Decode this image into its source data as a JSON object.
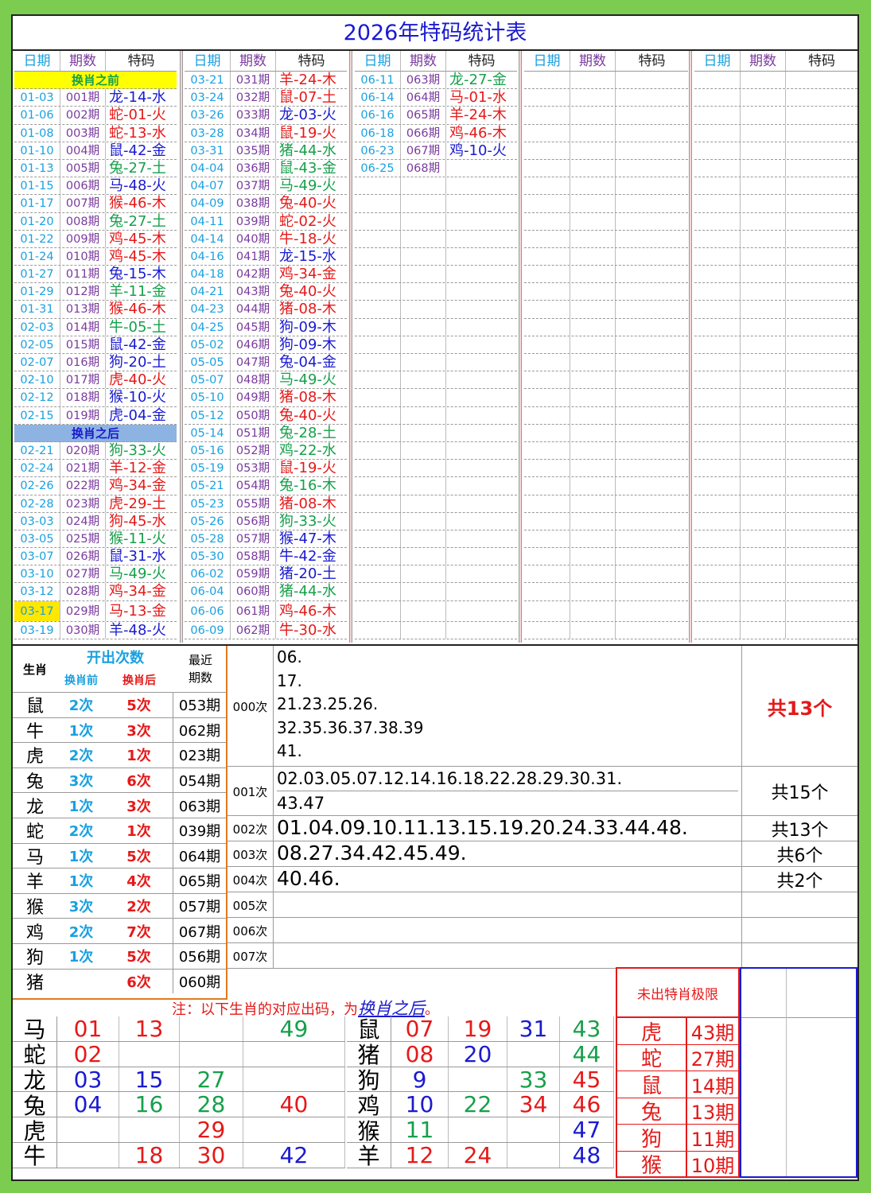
{
  "title": "2026年特码统计表",
  "headers": {
    "date": "日期",
    "period": "期数",
    "code": "特码"
  },
  "sep_before": "换肖之前",
  "sep_after": "换肖之后",
  "col1": [
    [
      "01-03",
      "001期",
      "龙-14-水",
      "bl"
    ],
    [
      "01-06",
      "002期",
      "蛇-01-火",
      "rd"
    ],
    [
      "01-08",
      "003期",
      "蛇-13-水",
      "rd"
    ],
    [
      "01-10",
      "004期",
      "鼠-42-金",
      "bl"
    ],
    [
      "01-13",
      "005期",
      "兔-27-土",
      "gr"
    ],
    [
      "01-15",
      "006期",
      "马-48-火",
      "bl"
    ],
    [
      "01-17",
      "007期",
      "猴-46-木",
      "rd"
    ],
    [
      "01-20",
      "008期",
      "兔-27-土",
      "gr"
    ],
    [
      "01-22",
      "009期",
      "鸡-45-木",
      "rd"
    ],
    [
      "01-24",
      "010期",
      "鸡-45-木",
      "rd"
    ],
    [
      "01-27",
      "011期",
      "兔-15-木",
      "bl"
    ],
    [
      "01-29",
      "012期",
      "羊-11-金",
      "gr"
    ],
    [
      "01-31",
      "013期",
      "猴-46-木",
      "rd"
    ],
    [
      "02-03",
      "014期",
      "牛-05-土",
      "gr"
    ],
    [
      "02-05",
      "015期",
      "鼠-42-金",
      "bl"
    ],
    [
      "02-07",
      "016期",
      "狗-20-土",
      "bl"
    ],
    [
      "02-10",
      "017期",
      "虎-40-火",
      "rd"
    ],
    [
      "02-12",
      "018期",
      "猴-10-火",
      "bl"
    ],
    [
      "02-15",
      "019期",
      "虎-04-金",
      "bl"
    ]
  ],
  "col1b": [
    [
      "02-21",
      "020期",
      "狗-33-火",
      "gr"
    ],
    [
      "02-24",
      "021期",
      "羊-12-金",
      "rd"
    ],
    [
      "02-26",
      "022期",
      "鸡-34-金",
      "rd"
    ],
    [
      "02-28",
      "023期",
      "虎-29-土",
      "rd"
    ],
    [
      "03-03",
      "024期",
      "狗-45-水",
      "rd"
    ],
    [
      "03-05",
      "025期",
      "猴-11-火",
      "gr"
    ],
    [
      "03-07",
      "026期",
      "鼠-31-水",
      "bl"
    ],
    [
      "03-10",
      "027期",
      "马-49-火",
      "gr"
    ],
    [
      "03-12",
      "028期",
      "鸡-34-金",
      "rd"
    ],
    [
      "03-17",
      "029期",
      "马-13-金",
      "rd"
    ],
    [
      "03-19",
      "030期",
      "羊-48-火",
      "bl"
    ]
  ],
  "col2": [
    [
      "03-21",
      "031期",
      "羊-24-木",
      "rd"
    ],
    [
      "03-24",
      "032期",
      "鼠-07-土",
      "rd"
    ],
    [
      "03-26",
      "033期",
      "龙-03-火",
      "bl"
    ],
    [
      "03-28",
      "034期",
      "鼠-19-火",
      "rd"
    ],
    [
      "03-31",
      "035期",
      "猪-44-水",
      "gr"
    ],
    [
      "04-04",
      "036期",
      "鼠-43-金",
      "gr"
    ],
    [
      "04-07",
      "037期",
      "马-49-火",
      "gr"
    ],
    [
      "04-09",
      "038期",
      "兔-40-火",
      "rd"
    ],
    [
      "04-11",
      "039期",
      "蛇-02-火",
      "rd"
    ],
    [
      "04-14",
      "040期",
      "牛-18-火",
      "rd"
    ],
    [
      "04-16",
      "041期",
      "龙-15-水",
      "bl"
    ],
    [
      "04-18",
      "042期",
      "鸡-34-金",
      "rd"
    ],
    [
      "04-21",
      "043期",
      "兔-40-火",
      "rd"
    ],
    [
      "04-23",
      "044期",
      "猪-08-木",
      "rd"
    ],
    [
      "04-25",
      "045期",
      "狗-09-木",
      "bl"
    ],
    [
      "05-02",
      "046期",
      "狗-09-木",
      "bl"
    ],
    [
      "05-05",
      "047期",
      "兔-04-金",
      "bl"
    ],
    [
      "05-07",
      "048期",
      "马-49-火",
      "gr"
    ],
    [
      "05-10",
      "049期",
      "猪-08-木",
      "rd"
    ],
    [
      "05-12",
      "050期",
      "兔-40-火",
      "rd"
    ],
    [
      "05-14",
      "051期",
      "兔-28-土",
      "gr"
    ],
    [
      "05-16",
      "052期",
      "鸡-22-水",
      "gr"
    ],
    [
      "05-19",
      "053期",
      "鼠-19-火",
      "rd"
    ],
    [
      "05-21",
      "054期",
      "兔-16-木",
      "gr"
    ],
    [
      "05-23",
      "055期",
      "猪-08-木",
      "rd"
    ],
    [
      "05-26",
      "056期",
      "狗-33-火",
      "gr"
    ],
    [
      "05-28",
      "057期",
      "猴-47-木",
      "bl"
    ],
    [
      "05-30",
      "058期",
      "牛-42-金",
      "bl"
    ],
    [
      "06-02",
      "059期",
      "猪-20-土",
      "bl"
    ],
    [
      "06-04",
      "060期",
      "猪-44-水",
      "gr"
    ],
    [
      "06-06",
      "061期",
      "鸡-46-木",
      "rd"
    ],
    [
      "06-09",
      "062期",
      "牛-30-水",
      "rd"
    ]
  ],
  "col3": [
    [
      "06-11",
      "063期",
      "龙-27-金",
      "gr"
    ],
    [
      "06-14",
      "064期",
      "马-01-水",
      "rd"
    ],
    [
      "06-16",
      "065期",
      "羊-24-木",
      "rd"
    ],
    [
      "06-18",
      "066期",
      "鸡-46-木",
      "rd"
    ],
    [
      "06-23",
      "067期",
      "鸡-10-火",
      "bl"
    ],
    [
      "06-25",
      "068期",
      "",
      ""
    ]
  ],
  "stats": {
    "h_zodiac": "生肖",
    "h_count": "开出次数",
    "h_before": "换肖前",
    "h_after": "换肖后",
    "h_recent": "最近期数",
    "rows": [
      [
        "鼠",
        "2次",
        "5次",
        "053期"
      ],
      [
        "牛",
        "1次",
        "3次",
        "062期"
      ],
      [
        "虎",
        "2次",
        "1次",
        "023期"
      ],
      [
        "兔",
        "3次",
        "6次",
        "054期"
      ],
      [
        "龙",
        "1次",
        "3次",
        "063期"
      ],
      [
        "蛇",
        "2次",
        "1次",
        "039期"
      ],
      [
        "马",
        "1次",
        "5次",
        "064期"
      ],
      [
        "羊",
        "1次",
        "4次",
        "065期"
      ],
      [
        "猴",
        "3次",
        "2次",
        "057期"
      ],
      [
        "鸡",
        "2次",
        "7次",
        "067期"
      ],
      [
        "狗",
        "1次",
        "5次",
        "056期"
      ],
      [
        "猪",
        "",
        "6次",
        "060期"
      ]
    ]
  },
  "freq": [
    {
      "label": "000次",
      "lines": [
        "06.",
        "17.",
        "21.23.25.26.",
        "32.35.36.37.38.39",
        "41."
      ],
      "total": "共13个"
    },
    {
      "label": "001次",
      "lines": [
        "02.03.05.07.12.14.16.18.22.28.29.30.31.",
        "43.47"
      ],
      "total": "共15个"
    },
    {
      "label": "002次",
      "lines": [
        "01.04.09.10.11.13.15.19.20.24.33.44.48."
      ],
      "total": "共13个"
    },
    {
      "label": "003次",
      "lines": [
        "08.27.34.42.45.49."
      ],
      "total": "共6个"
    },
    {
      "label": "004次",
      "lines": [
        "40.46."
      ],
      "total": "共2个"
    },
    {
      "label": "005次",
      "lines": [],
      "total": ""
    },
    {
      "label": "006次",
      "lines": [],
      "total": ""
    },
    {
      "label": "007次",
      "lines": [],
      "total": ""
    }
  ],
  "note_prefix": "注：以下生肖的对应出码，为",
  "note_link": "换肖之后",
  "note_suffix": "。",
  "limit_title": "未出特肖极限",
  "limit": [
    [
      "虎",
      "43期"
    ],
    [
      "蛇",
      "27期"
    ],
    [
      "鼠",
      "14期"
    ],
    [
      "兔",
      "13期"
    ],
    [
      "狗",
      "11期"
    ],
    [
      "猴",
      "10期"
    ]
  ],
  "zodiac_left": [
    [
      "马",
      [
        "01",
        "rd"
      ],
      [
        "13",
        "rd"
      ],
      [
        "",
        ""
      ],
      [
        "49",
        "gr"
      ]
    ],
    [
      "蛇",
      [
        "02",
        "rd"
      ],
      [
        "",
        ""
      ],
      [
        "",
        ""
      ],
      [
        "",
        ""
      ]
    ],
    [
      "龙",
      [
        "03",
        "bl"
      ],
      [
        "15",
        "bl"
      ],
      [
        "27",
        "gr"
      ],
      [
        "",
        ""
      ]
    ],
    [
      "兔",
      [
        "04",
        "bl"
      ],
      [
        "16",
        "gr"
      ],
      [
        "28",
        "gr"
      ],
      [
        "40",
        "rd"
      ]
    ],
    [
      "虎",
      [
        "",
        ""
      ],
      [
        "",
        ""
      ],
      [
        "29",
        "rd"
      ],
      [
        "",
        ""
      ]
    ],
    [
      "牛",
      [
        "",
        ""
      ],
      [
        "18",
        "rd"
      ],
      [
        "30",
        "rd"
      ],
      [
        "42",
        "bl"
      ]
    ]
  ],
  "zodiac_right": [
    [
      "鼠",
      [
        "07",
        "rd"
      ],
      [
        "19",
        "rd"
      ],
      [
        "31",
        "bl"
      ],
      [
        "43",
        "gr"
      ]
    ],
    [
      "猪",
      [
        "08",
        "rd"
      ],
      [
        "20",
        "bl"
      ],
      [
        "",
        ""
      ],
      [
        "44",
        "gr"
      ]
    ],
    [
      "狗",
      [
        "9",
        "bl"
      ],
      [
        "",
        ""
      ],
      [
        "33",
        "gr"
      ],
      [
        "45",
        "rd"
      ]
    ],
    [
      "鸡",
      [
        "10",
        "bl"
      ],
      [
        "22",
        "gr"
      ],
      [
        "34",
        "rd"
      ],
      [
        "46",
        "rd"
      ]
    ],
    [
      "猴",
      [
        "11",
        "gr"
      ],
      [
        "",
        ""
      ],
      [
        "",
        ""
      ],
      [
        "47",
        "bl"
      ]
    ],
    [
      "羊",
      [
        "12",
        "rd"
      ],
      [
        "24",
        "rd"
      ],
      [
        "",
        ""
      ],
      [
        "48",
        "bl"
      ]
    ]
  ],
  "colors": {
    "red": "#e51919",
    "blue": "#1a1ad0",
    "green": "#16a04a",
    "highlight": "#ffe700",
    "sep_after_bg": "#8db3e2",
    "sep_before_bg": "#ffff00"
  }
}
